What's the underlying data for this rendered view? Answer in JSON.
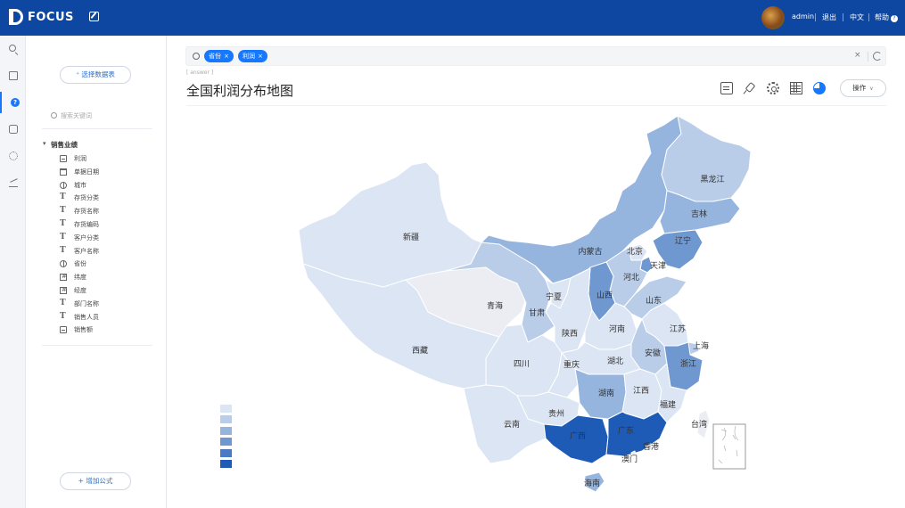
{
  "app": {
    "brand": "FOCUS"
  },
  "header": {
    "user": "admin",
    "logout": "退出",
    "lang": "中文",
    "help": "帮助",
    "help_icon": "?"
  },
  "rail": {
    "help_icon": "?"
  },
  "panel": {
    "select_table": "⁺ 选择数据表",
    "search_placeholder": "搜索关键词",
    "group": "销售业绩",
    "fields": [
      {
        "label": "利润",
        "icon": "measure"
      },
      {
        "label": "单据日期",
        "icon": "date"
      },
      {
        "label": "城市",
        "icon": "geo"
      },
      {
        "label": "存货分类",
        "icon": "text"
      },
      {
        "label": "存货名称",
        "icon": "text"
      },
      {
        "label": "存货编码",
        "icon": "text"
      },
      {
        "label": "客户分类",
        "icon": "text"
      },
      {
        "label": "客户名称",
        "icon": "text"
      },
      {
        "label": "省份",
        "icon": "geo"
      },
      {
        "label": "纬度",
        "icon": "num"
      },
      {
        "label": "经度",
        "icon": "num"
      },
      {
        "label": "部门名称",
        "icon": "text"
      },
      {
        "label": "销售人员",
        "icon": "text"
      },
      {
        "label": "销售额",
        "icon": "measure"
      }
    ],
    "add_formula": "+ 增加公式"
  },
  "search": {
    "tags": [
      "省份",
      "利润"
    ],
    "tag_close": "×",
    "clear": "×"
  },
  "breadcrumb": "[ answer ]",
  "page_title": "全国利润分布地图",
  "toolbar": {
    "operations": "操作",
    "caret": "∨"
  },
  "legend_colors": [
    "#dce5f3",
    "#b9cde9",
    "#95b4de",
    "#6f97d0",
    "#4a7bc2",
    "#1d5bb6"
  ],
  "chart_data": {
    "type": "map",
    "title": "全国利润分布地图",
    "region": "China provinces",
    "measure": "利润",
    "regions": [
      {
        "name": "新疆",
        "level": 1
      },
      {
        "name": "西藏",
        "level": 1
      },
      {
        "name": "青海",
        "level": 0
      },
      {
        "name": "甘肃",
        "level": 2
      },
      {
        "name": "内蒙古",
        "level": 3
      },
      {
        "name": "黑龙江",
        "level": 2
      },
      {
        "name": "吉林",
        "level": 3
      },
      {
        "name": "辽宁",
        "level": 4
      },
      {
        "name": "北京",
        "level": 1
      },
      {
        "name": "天津",
        "level": 4
      },
      {
        "name": "河北",
        "level": 2
      },
      {
        "name": "山西",
        "level": 4
      },
      {
        "name": "山东",
        "level": 2
      },
      {
        "name": "宁夏",
        "level": 1
      },
      {
        "name": "陕西",
        "level": 1
      },
      {
        "name": "河南",
        "level": 1
      },
      {
        "name": "江苏",
        "level": 1
      },
      {
        "name": "上海",
        "level": 2
      },
      {
        "name": "安徽",
        "level": 2
      },
      {
        "name": "浙江",
        "level": 4
      },
      {
        "name": "湖北",
        "level": 1
      },
      {
        "name": "四川",
        "level": 1
      },
      {
        "name": "重庆",
        "level": 1
      },
      {
        "name": "湖南",
        "level": 3
      },
      {
        "name": "江西",
        "level": 1
      },
      {
        "name": "福建",
        "level": 1
      },
      {
        "name": "贵州",
        "level": 1
      },
      {
        "name": "云南",
        "level": 1
      },
      {
        "name": "广西",
        "level": 6
      },
      {
        "name": "广东",
        "level": 6
      },
      {
        "name": "香港",
        "level": 0
      },
      {
        "name": "澳门",
        "level": 0
      },
      {
        "name": "海南",
        "level": 3
      },
      {
        "name": "台湾",
        "level": 0
      }
    ],
    "legend_steps": 6
  }
}
